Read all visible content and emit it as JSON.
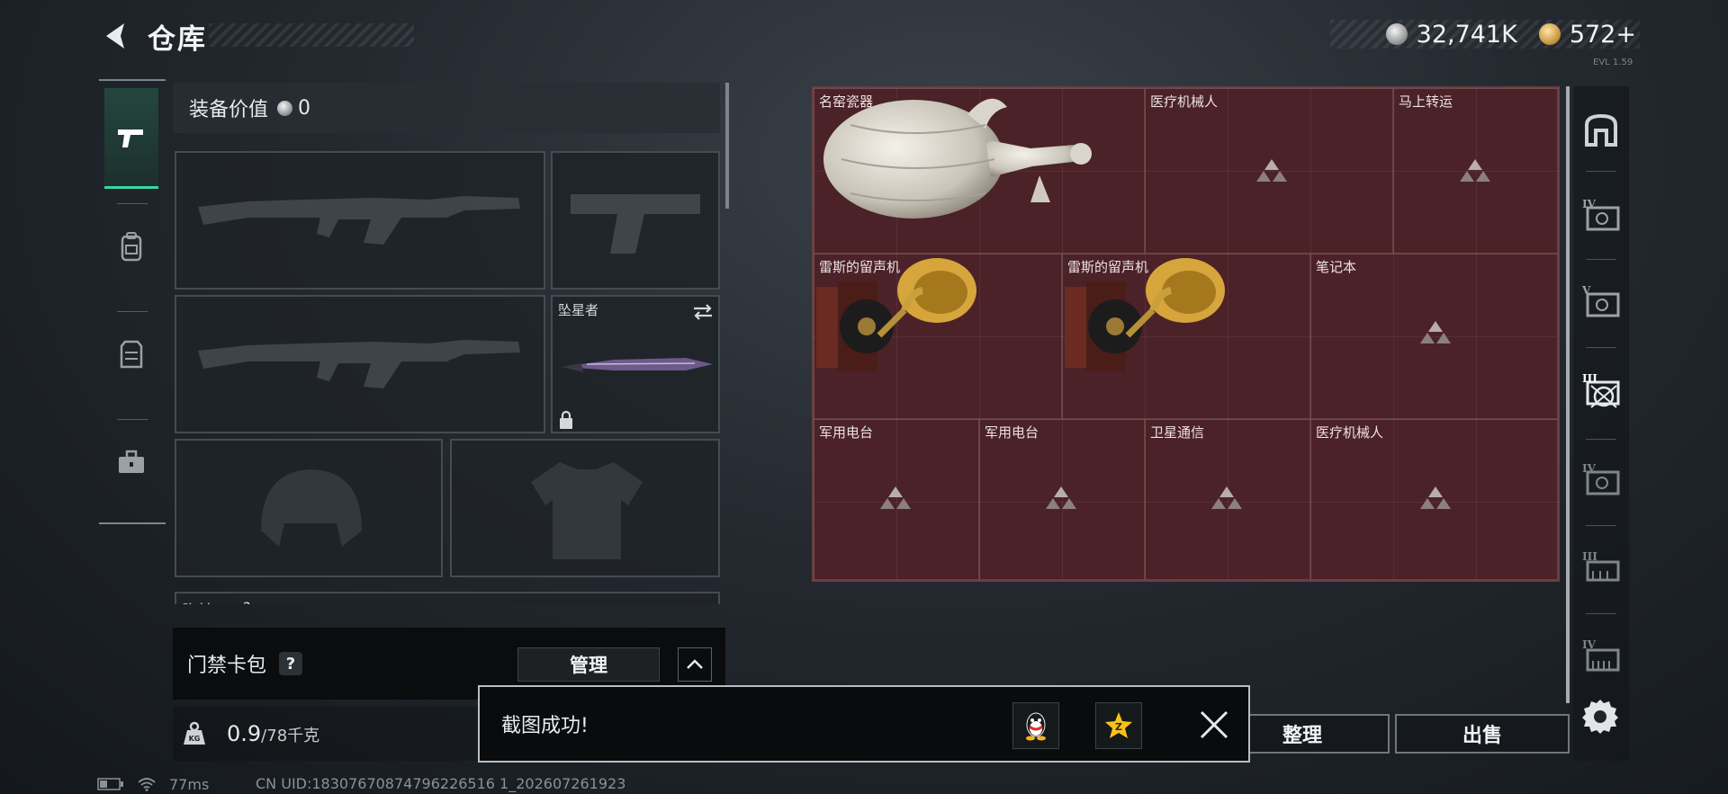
{
  "header": {
    "title": "仓库",
    "currencies": [
      {
        "name": "silver-coin",
        "value": "32,741K"
      },
      {
        "name": "gold-coin",
        "value": "572+"
      }
    ],
    "version": "EVL 1.59"
  },
  "left_tabs": [
    {
      "icon": "pistol-icon",
      "active": true
    },
    {
      "icon": "backpack-icon",
      "active": false
    },
    {
      "icon": "vest-icon",
      "active": false
    },
    {
      "icon": "toolbox-icon",
      "active": false
    }
  ],
  "equipment": {
    "value_label": "装备价值",
    "value": "0",
    "melee_label": "坠星者",
    "chest_label": "胸挂",
    "chest_help": "?"
  },
  "card_pack": {
    "label": "门禁卡包",
    "help": "?",
    "manage_label": "管理"
  },
  "weight": {
    "current": "0.9",
    "max": "/78千克"
  },
  "stash": {
    "items": [
      {
        "label": "名窑瓷器",
        "kind": "vase"
      },
      {
        "label": "医疗机械人",
        "kind": "placeholder"
      },
      {
        "label": "马上转运",
        "kind": "placeholder"
      },
      {
        "label": "雷斯的留声机",
        "kind": "gramophone"
      },
      {
        "label": "雷斯的留声机",
        "kind": "gramophone"
      },
      {
        "label": "笔记本",
        "kind": "placeholder"
      },
      {
        "label": "军用电台",
        "kind": "placeholder"
      },
      {
        "label": "军用电台",
        "kind": "placeholder"
      },
      {
        "label": "卫星通信",
        "kind": "placeholder"
      },
      {
        "label": "医疗机械人",
        "kind": "placeholder"
      }
    ]
  },
  "categories": [
    "IV",
    "V",
    "III",
    "IV",
    "III",
    "IV"
  ],
  "actions": {
    "tidy_label": "整理",
    "sell_label": "出售"
  },
  "toast": {
    "message": "截图成功!"
  },
  "status": {
    "ping": "77ms",
    "uid": "CN UID:18307670874796226516 1_202607261923"
  }
}
